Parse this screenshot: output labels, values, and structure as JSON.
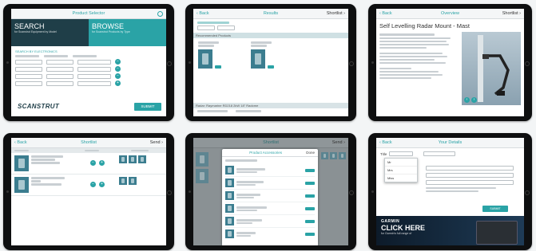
{
  "screen1": {
    "nav_title": "Product Selector",
    "search_title": "SEARCH",
    "search_subtitle": "for Scanstrut Equipment by Model",
    "browse_title": "BROWSE",
    "browse_subtitle": "for Scanstrut Products by Type",
    "section_label": "SEARCH BY ELECTRONICS",
    "brand": "SCANSTRUT",
    "submit_label": "SUBMIT"
  },
  "screen2": {
    "nav_back": "Back",
    "nav_title": "Results",
    "nav_right": "Shortlist",
    "recommended_header": "Recommended Products",
    "footer_text": "Radar: Raymarine RD218 2kW 18\" Radome"
  },
  "screen3": {
    "nav_back": "Back",
    "nav_title": "Overview",
    "nav_right": "Shortlist",
    "product_title": "Self Levelling Radar Mount - Mast"
  },
  "screen4": {
    "nav_back": "Back",
    "nav_title": "Shortlist",
    "nav_right": "Send"
  },
  "screen5": {
    "nav_title": "Shortlist",
    "nav_right": "Send",
    "modal_title": "Product Accessories",
    "modal_done": "Done"
  },
  "screen6": {
    "nav_back": "Back",
    "nav_title": "Your Details",
    "form_label": "Title",
    "dropdown_options": [
      "Mr",
      "Mrs",
      "Miss"
    ],
    "submit_label": "SUBMIT",
    "ad_brand": "GARMIN",
    "ad_cta": "CLICK HERE",
    "ad_sub": "for Garmin's full range of"
  }
}
